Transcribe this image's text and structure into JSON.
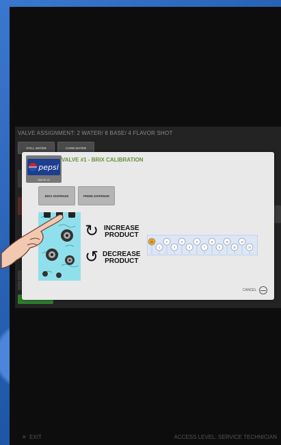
{
  "panel": {
    "title": "VALVE ASSIGNMENT: 2 WATER/ 8 BASE/ 4 FLAVOR SHOT",
    "buttons": [
      "STILL WATER",
      "CARB WATER"
    ]
  },
  "dialog": {
    "title": "VALVE #1  - BRIX CALIBRATION",
    "brand": {
      "logo_text": "pepsi",
      "valve_label": "VALVE #1"
    },
    "brix_button": "BRIX DISPENSE",
    "prime_button": "PRIME DISPENSE",
    "increase_label_1": "INCREASE",
    "increase_label_2": "PRODUCT",
    "decrease_label_1": "DECREASE",
    "decrease_label_2": "PRODUCT",
    "nozzle_numbers": [
      "W",
      "1",
      "2",
      "3",
      "4",
      "5",
      "6",
      "7",
      "8",
      "9",
      "10",
      "11",
      "12",
      "13"
    ],
    "cancel_label": "CANCEL"
  },
  "footer": {
    "exit_label": "EXIT",
    "access_label": "ACCESS LEVEL: SERVICE TECHNICIAN"
  },
  "colors": {
    "dialog_title": "#6d8d3c",
    "nozzle_highlight": "#f0a020",
    "valve_teal": "#8fe0ec"
  }
}
